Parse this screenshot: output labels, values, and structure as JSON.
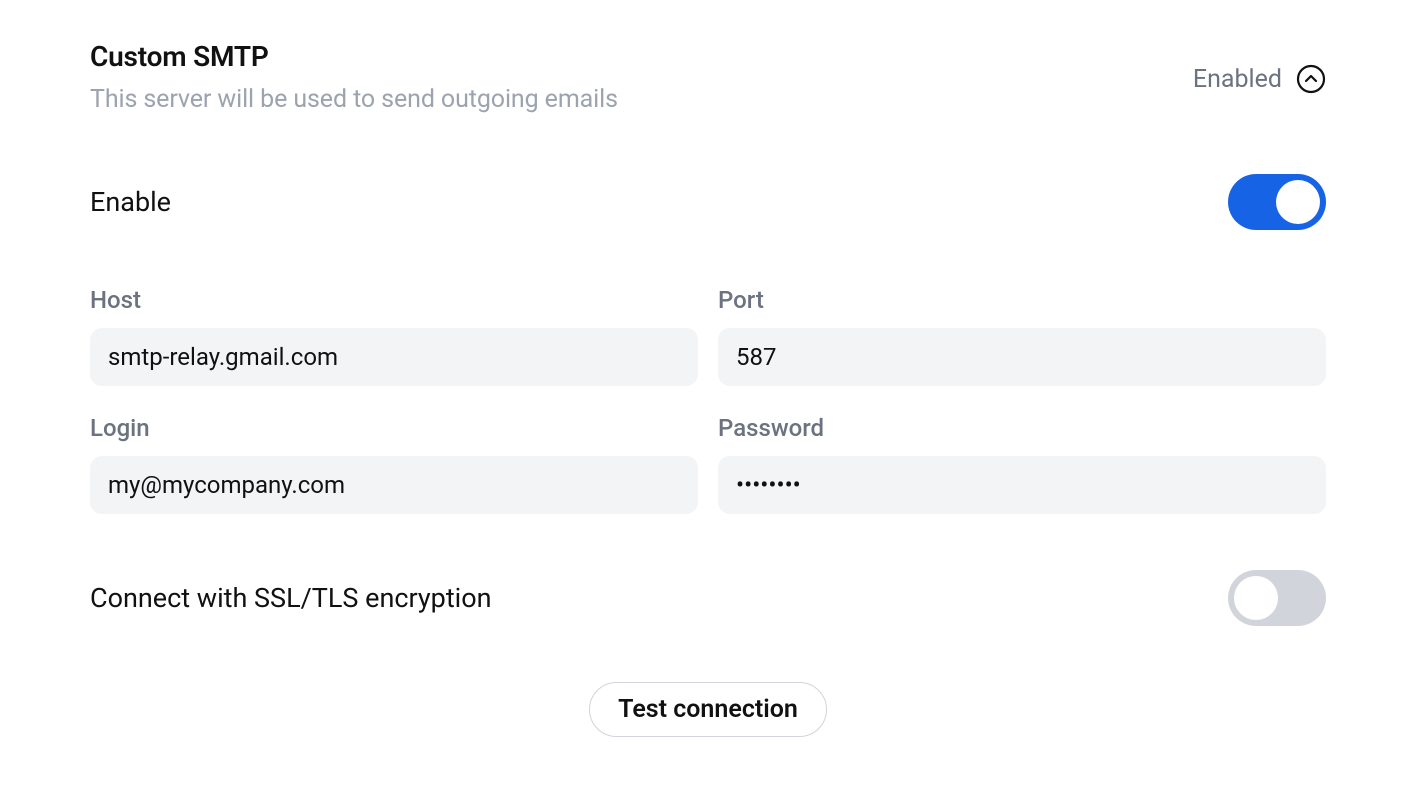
{
  "header": {
    "title": "Custom SMTP",
    "description": "This server will be used to send outgoing emails",
    "status_label": "Enabled"
  },
  "enable_row": {
    "label": "Enable",
    "value": true
  },
  "fields": {
    "host": {
      "label": "Host",
      "value": "smtp-relay.gmail.com"
    },
    "port": {
      "label": "Port",
      "value": "587"
    },
    "login": {
      "label": "Login",
      "value": "my@mycompany.com"
    },
    "password": {
      "label": "Password",
      "value": "••••••••"
    }
  },
  "ssl_row": {
    "label": "Connect with SSL/TLS encryption",
    "value": false
  },
  "test_button": {
    "label": "Test connection"
  }
}
